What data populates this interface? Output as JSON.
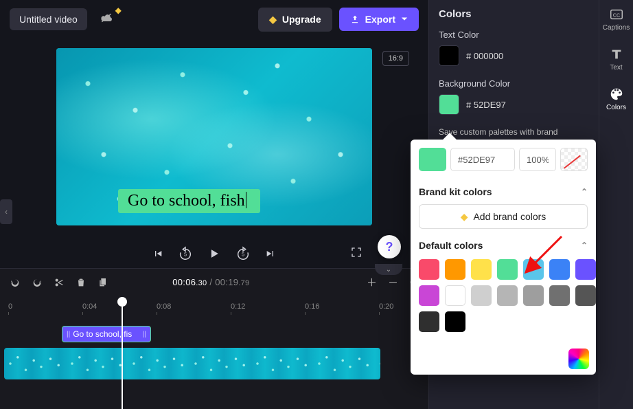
{
  "header": {
    "title": "Untitled video",
    "upgrade_label": "Upgrade",
    "export_label": "Export",
    "aspect_badge": "16:9"
  },
  "caption": {
    "text": "Go to school, fish"
  },
  "player": {
    "current_time_main": "00:06",
    "current_time_frac": ".30",
    "duration_main": "00:19",
    "duration_frac": ".79"
  },
  "timeline": {
    "ticks": [
      "0",
      "0:04",
      "0:08",
      "0:12",
      "0:16",
      "0:20"
    ],
    "text_clip_label": "Go to school, fis"
  },
  "panel": {
    "heading": "Colors",
    "text_color_label": "Text Color",
    "text_color_hex": "# 000000",
    "bg_color_label": "Background Color",
    "bg_color_hex": "# 52DE97",
    "brand_palette_hint": "Save custom palettes with brand"
  },
  "popover": {
    "hex": "#52DE97",
    "opacity": "100%",
    "brand_section": "Brand kit colors",
    "add_brand_label": "Add brand colors",
    "default_section": "Default colors",
    "swatches": [
      "#f94a6a",
      "#ff9800",
      "#ffe14a",
      "#52de97",
      "#5ac5ea",
      "#3b82f6",
      "#6a52ff",
      "#c946d6",
      "#ffffff",
      "#cfcfcf",
      "#b5b5b5",
      "#9e9e9e",
      "#707070",
      "#555555",
      "#2f2f2f",
      "#000000"
    ]
  },
  "sidebar": {
    "captions": "Captions",
    "text": "Text",
    "colors": "Colors"
  }
}
